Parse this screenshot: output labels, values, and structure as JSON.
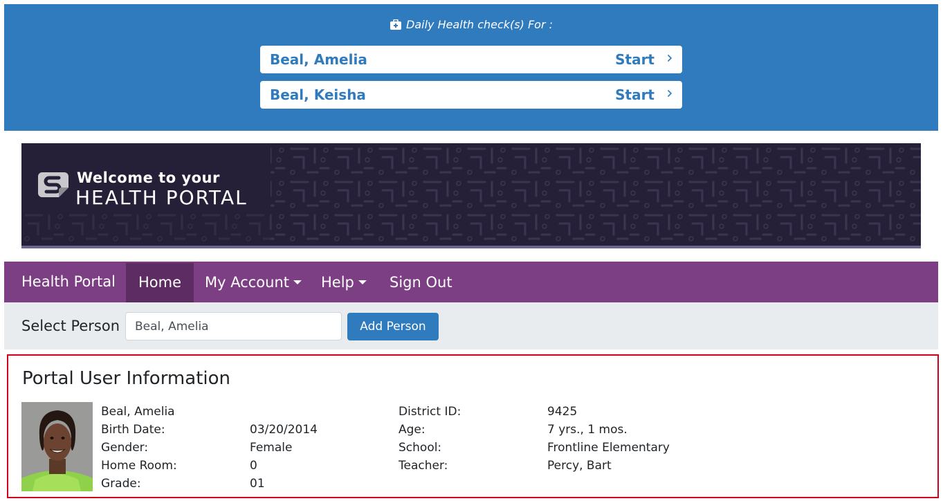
{
  "health_checks": {
    "title": "Daily Health check(s) For :",
    "title_icon": "medical-kit-icon",
    "items": [
      {
        "name": "Beal, Amelia",
        "action": "Start"
      },
      {
        "name": "Beal, Keisha",
        "action": "Start"
      }
    ]
  },
  "hero": {
    "welcome": "Welcome to your",
    "portal": "HEALTH PORTAL",
    "logo_icon": "frontline-logo-icon"
  },
  "navbar": {
    "brand": "Health Portal",
    "items": [
      {
        "label": "Home",
        "active": true
      },
      {
        "label": "My Account",
        "dropdown": true
      },
      {
        "label": "Help",
        "dropdown": true
      },
      {
        "label": "Sign Out"
      }
    ]
  },
  "select_person": {
    "label": "Select Person",
    "value": "Beal, Amelia",
    "add_button": "Add Person"
  },
  "user_info": {
    "title": "Portal User Information",
    "name": "Beal, Amelia",
    "left": [
      {
        "label": "Birth Date:",
        "value": "03/20/2014"
      },
      {
        "label": "Gender:",
        "value": "Female"
      },
      {
        "label": "Home Room:",
        "value": "0"
      },
      {
        "label": "Grade:",
        "value": "01"
      }
    ],
    "right": [
      {
        "label": "District ID:",
        "value": "9425"
      },
      {
        "label": "Age:",
        "value": "7 yrs., 1 mos."
      },
      {
        "label": "School:",
        "value": "Frontline Elementary"
      },
      {
        "label": "Teacher:",
        "value": "Percy, Bart"
      }
    ]
  },
  "colors": {
    "primary_blue": "#2f7bbd",
    "nav_purple": "#7d3f83",
    "nav_active": "#5c2c62",
    "hero_bg": "#252038",
    "highlight_border": "#d0021b"
  }
}
